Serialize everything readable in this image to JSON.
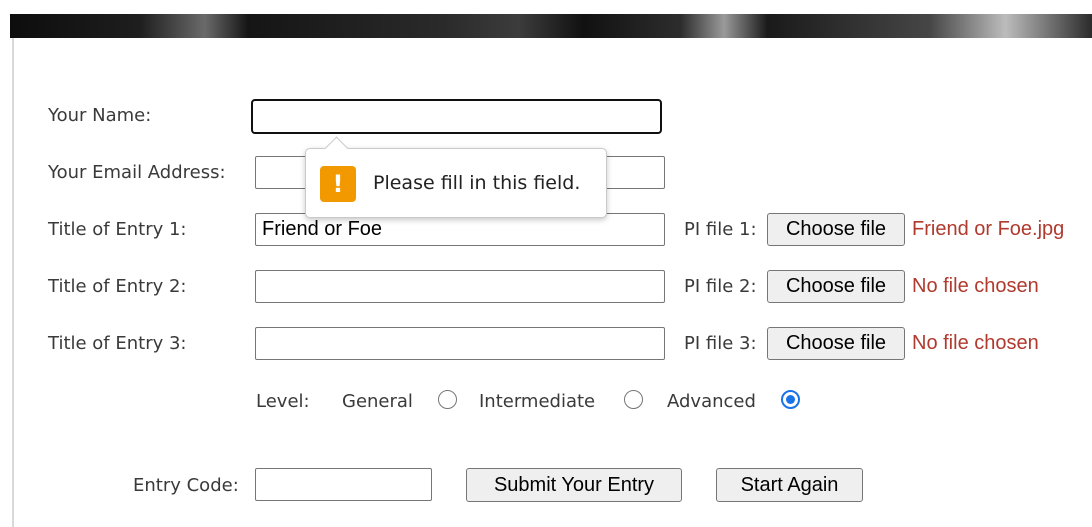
{
  "form": {
    "name_label": "Your Name:",
    "name_value": "",
    "email_label": "Your Email Address:",
    "email_value": "",
    "entries": [
      {
        "title_label": "Title of Entry 1:",
        "title_value": "Friend or Foe",
        "pi_label": "PI file 1:",
        "file_button": "Choose file",
        "file_status": "Friend or Foe.jpg"
      },
      {
        "title_label": "Title of Entry 2:",
        "title_value": "",
        "pi_label": "PI file 2:",
        "file_button": "Choose file",
        "file_status": "No file chosen"
      },
      {
        "title_label": "Title of Entry 3:",
        "title_value": "",
        "pi_label": "PI file 3:",
        "file_button": "Choose file",
        "file_status": "No file chosen"
      }
    ],
    "level": {
      "label": "Level:",
      "options": [
        "General",
        "Intermediate",
        "Advanced"
      ],
      "selected": "Advanced"
    },
    "entry_code_label": "Entry Code:",
    "entry_code_value": "",
    "submit_label": "Submit Your Entry",
    "reset_label": "Start Again"
  },
  "validation_tooltip": {
    "icon": "warning-icon",
    "message": "Please fill in this field."
  },
  "colors": {
    "file_status": "#b03a2e",
    "radio_selected": "#1a73e8",
    "warning": "#f29900"
  }
}
